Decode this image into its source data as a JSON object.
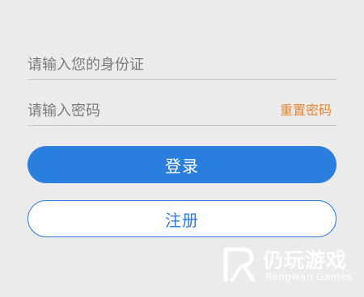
{
  "form": {
    "id_placeholder": "请输入您的身份证",
    "password_placeholder": "请输入密码",
    "reset_password_label": "重置密码"
  },
  "buttons": {
    "login_label": "登录",
    "register_label": "注册"
  },
  "watermark": {
    "title": "仍玩游戏",
    "subtitle": "Rengwan Games",
    "logo_icon": "rengwan-logo-icon"
  },
  "colors": {
    "primary": "#2a7fde",
    "accent": "#e8842e",
    "background": "#ebebeb"
  }
}
